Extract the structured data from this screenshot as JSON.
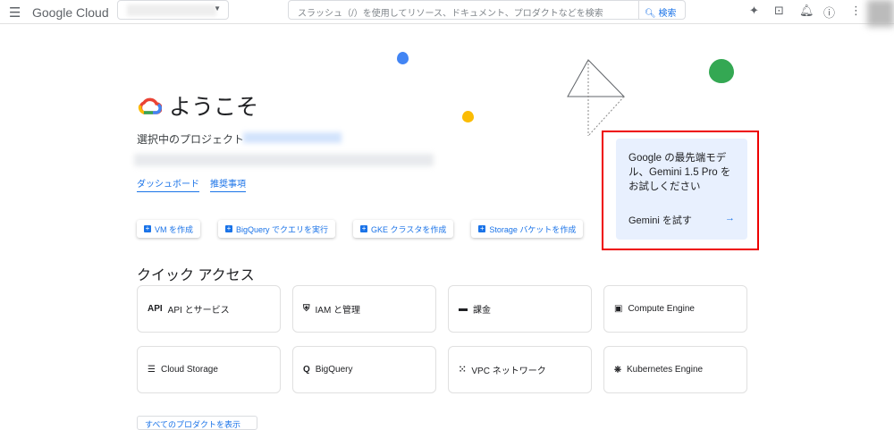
{
  "topbar": {
    "menu_icon": "☰",
    "logo": "Google Cloud",
    "search_placeholder": "スラッシュ（/）を使用してリソース、ドキュメント、プロダクトなどを検索",
    "search_button": "検索",
    "icons": [
      "gemini-icon",
      "terminal-icon",
      "bell-icon",
      "help-icon",
      "more-icon"
    ]
  },
  "welcome": {
    "title": "ようこそ",
    "selected_project_label": "選択中のプロジェクト",
    "links": [
      "ダッシュボード",
      "推奨事項"
    ]
  },
  "actions": [
    "VM を作成",
    "BigQuery でクエリを実行",
    "GKE クラスタを作成",
    "Storage バケットを作成"
  ],
  "quick_access": {
    "title": "クイック アクセス",
    "items": [
      {
        "icon": "API",
        "label": "API とサービス"
      },
      {
        "icon": "⛨",
        "label": "IAM と管理"
      },
      {
        "icon": "▬",
        "label": "課金"
      },
      {
        "icon": "▣",
        "label": "Compute Engine"
      },
      {
        "icon": "☰",
        "label": "Cloud Storage"
      },
      {
        "icon": "Q",
        "label": "BigQuery"
      },
      {
        "icon": "⁙",
        "label": "VPC ネットワーク"
      },
      {
        "icon": "⎈",
        "label": "Kubernetes Engine"
      }
    ],
    "all_products": "すべてのプロダクトを表示"
  },
  "promo": {
    "text": "Google の最先端モデル、Gemini 1.5 Pro をお試しください",
    "cta": "Gemini を試す",
    "arrow": "→"
  },
  "colors": {
    "accent": "#1a73e8",
    "highlight": "#e00000",
    "promo_bg": "#e8f0fe"
  }
}
